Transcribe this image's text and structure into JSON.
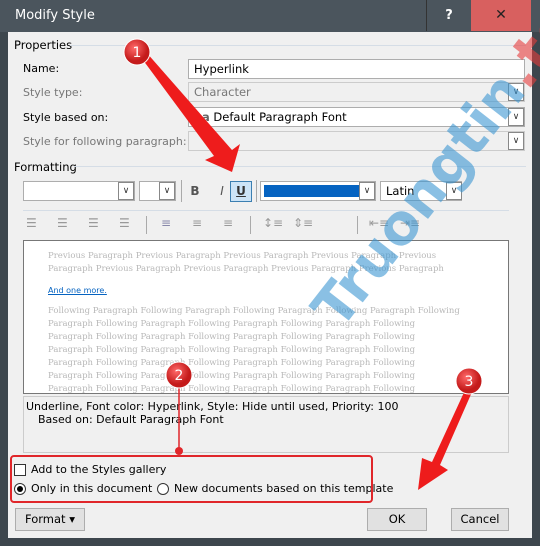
{
  "window": {
    "title": "Modify Style",
    "help": "?",
    "close": "✕"
  },
  "properties": {
    "heading": "Properties",
    "name_label": "Name:",
    "name_value": "Hyperlink",
    "style_type_label": "Style type:",
    "style_type_value": "Character",
    "based_on_label": "Style based on:",
    "based_on_icon": "a",
    "based_on_value": "Default Paragraph Font",
    "following_label": "Style for following paragraph:",
    "following_value": ""
  },
  "formatting": {
    "heading": "Formatting",
    "font": "",
    "size": "",
    "bold": "B",
    "italic": "I",
    "underline": "U",
    "underline_active": true,
    "font_color": "#0563c1",
    "script": "Latin"
  },
  "preview": {
    "previous": "Previous Paragraph Previous Paragraph Previous Paragraph Previous Paragraph Previous Paragraph Previous Paragraph Previous Paragraph Previous Paragraph Previous Paragraph Previous Paragraph",
    "sample": "And one more.",
    "following": "Following Paragraph Following Paragraph Following Paragraph Following Paragraph Following Paragraph Following Paragraph Following Paragraph Following Paragraph Following Paragraph Following Paragraph Following Paragraph Following Paragraph Following Paragraph Following Paragraph Following Paragraph Following Paragraph Following Paragraph Following Paragraph Following Paragraph Following Paragraph Following Paragraph Following Paragraph Following Paragraph Following Paragraph Following Paragraph Following Paragraph Following Paragraph Following Paragraph Following Paragraph Following Paragraph Following Paragraph Following Paragraph Following Paragraph Following Paragraph Following Paragraph"
  },
  "description": {
    "line1": "Underline, Font color: Hyperlink, Style: Hide until used, Priority: 100",
    "line2": "Based on: Default Paragraph Font"
  },
  "options": {
    "add_gallery": "Add to the Styles gallery",
    "add_gallery_checked": false,
    "only_doc": "Only in this document",
    "new_docs": "New documents based on this template",
    "selected": "only_doc"
  },
  "buttons": {
    "format": "Format",
    "ok": "OK",
    "cancel": "Cancel"
  },
  "annotations": {
    "one": "1",
    "two": "2",
    "three": "3",
    "color": "#e0262a"
  },
  "watermark": "Truongtin.top"
}
